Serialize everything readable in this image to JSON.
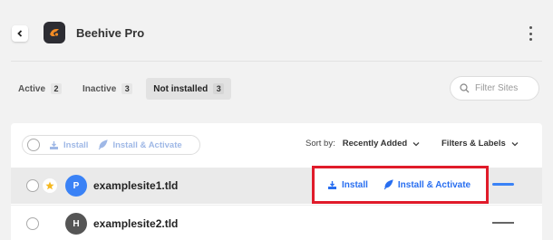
{
  "header": {
    "title": "Beehive Pro",
    "logo_color": "#2d2d33",
    "logo_accent": "#f08a24"
  },
  "tabs": [
    {
      "label": "Active",
      "count": "2",
      "active": false
    },
    {
      "label": "Inactive",
      "count": "3",
      "active": false
    },
    {
      "label": "Not installed",
      "count": "3",
      "active": true
    }
  ],
  "search": {
    "placeholder": "Filter Sites"
  },
  "bulk_actions": {
    "install_label": "Install",
    "install_activate_label": "Install & Activate"
  },
  "sort": {
    "label": "Sort by:",
    "value": "Recently Added"
  },
  "filters": {
    "label": "Filters & Labels"
  },
  "sites": [
    {
      "initial": "P",
      "name": "examplesite1.tld",
      "avatar_color": "#3a82f6",
      "starred": true
    },
    {
      "initial": "H",
      "name": "examplesite2.tld",
      "avatar_color": "#555555",
      "starred": false
    }
  ],
  "row_actions": {
    "install_label": "Install",
    "install_activate_label": "Install & Activate"
  },
  "colors": {
    "accent": "#286ef0",
    "highlight": "#e01b2a",
    "muted_action": "#9fb8e6"
  }
}
